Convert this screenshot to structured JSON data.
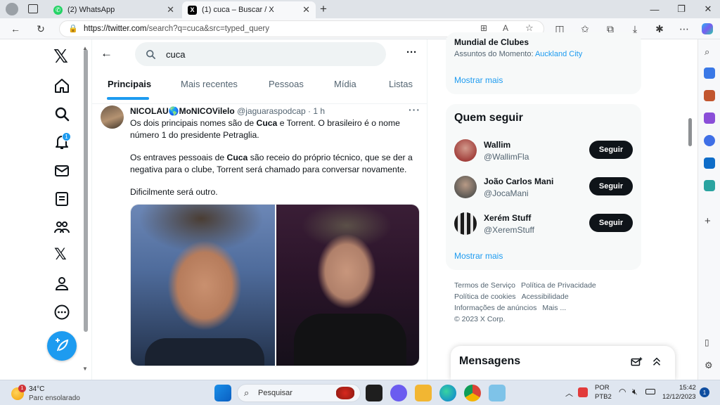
{
  "browser": {
    "tabs": [
      {
        "title": "(2) WhatsApp",
        "icon": "whatsapp-icon",
        "color": "#25d366"
      },
      {
        "title": "(1) cuca – Buscar / X",
        "icon": "x-icon",
        "color": "#000000"
      }
    ],
    "url_host": "https://twitter.com",
    "url_path": "/search?q=cuca&src=typed_query"
  },
  "nav": {
    "items": [
      "home-icon",
      "explore-icon",
      "notifications-icon",
      "messages-icon",
      "lists-icon",
      "communities-icon",
      "premium-icon",
      "profile-icon",
      "more-icon"
    ],
    "notification_badge": "1",
    "accent": "#1d9bf0"
  },
  "search": {
    "query": "cuca"
  },
  "tabs": [
    {
      "label": "Principais",
      "active": true
    },
    {
      "label": "Mais recentes",
      "active": false
    },
    {
      "label": "Pessoas",
      "active": false
    },
    {
      "label": "Mídia",
      "active": false
    },
    {
      "label": "Listas",
      "active": false
    }
  ],
  "tweet": {
    "name": "NICOLAU🌎MoNICOVilelo",
    "handle": "@jaguaraspodcap",
    "sep": "·",
    "time": "1 h",
    "p1_a": "Os dois principais nomes são de ",
    "p1_bold": "Cuca",
    "p1_b": " e Torrent. O brasileiro é o nome número 1 do presidente Petraglia.",
    "p2_a": "Os entraves pessoais de ",
    "p2_bold": "Cuca",
    "p2_b": " são receio do próprio técnico, que se der a negativa para o clube, Torrent será chamado para conversar novamente.",
    "p3": "Dificilmente será outro."
  },
  "trend": {
    "title": "Mundial de Clubes",
    "sub_prefix": "Assuntos do Momento: ",
    "sub_link": "Auckland City",
    "show_more": "Mostrar mais"
  },
  "who_to_follow": {
    "title": "Quem seguir",
    "users": [
      {
        "name": "Wallim",
        "handle": "@WallimFla",
        "button": "Seguir"
      },
      {
        "name": "João Carlos Mani",
        "handle": "@JocaMani",
        "button": "Seguir"
      },
      {
        "name": "Xerém Stuff",
        "handle": "@XeremStuff",
        "button": "Seguir"
      }
    ],
    "show_more": "Mostrar mais"
  },
  "footer": {
    "links": [
      "Termos de Serviço",
      "Política de Privacidade",
      "Política de cookies",
      "Acessibilidade",
      "Informações de anúncios",
      "Mais ..."
    ],
    "copyright": "© 2023 X Corp."
  },
  "messages": {
    "title": "Mensagens"
  },
  "taskbar": {
    "weather_temp": "34°C",
    "weather_desc": "Parc ensolarado",
    "weather_badge": "1",
    "search_placeholder": "Pesquisar",
    "lang_1": "POR",
    "lang_2": "PTB2",
    "time": "15:42",
    "date": "12/12/2023",
    "notification_count": "1"
  }
}
